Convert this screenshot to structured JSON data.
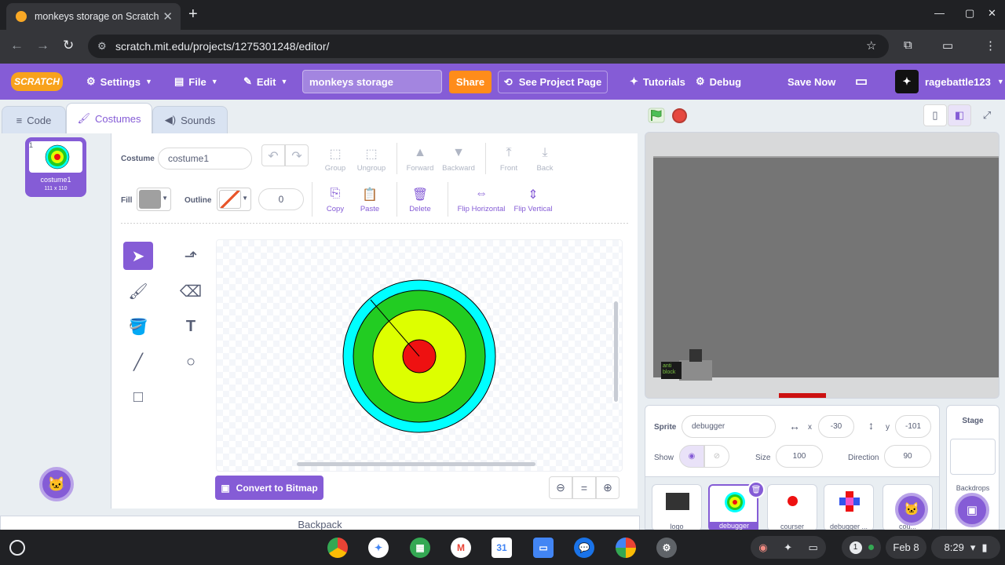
{
  "browser": {
    "tab_title": "monkeys storage on Scratch",
    "url": "scratch.mit.edu/projects/1275301248/editor/"
  },
  "menubar": {
    "logo": "SCRATCH",
    "settings": "Settings",
    "file": "File",
    "edit": "Edit",
    "project_title": "monkeys storage",
    "share": "Share",
    "see_project_page": "See Project Page",
    "tutorials": "Tutorials",
    "debug": "Debug",
    "save_now": "Save Now",
    "username": "ragebattle123"
  },
  "editor_tabs": [
    "Code",
    "Costumes",
    "Sounds"
  ],
  "costume_list": [
    {
      "index": "1",
      "name": "costume1",
      "size": "111 x 110"
    }
  ],
  "paint_editor": {
    "costume_label": "Costume",
    "costume_name": "costume1",
    "fill_label": "Fill",
    "outline_label": "Outline",
    "outline_width": "0",
    "fill_color": "#a0a0a0",
    "toolbar_top": [
      "Group",
      "Ungroup",
      "Forward",
      "Backward",
      "Front",
      "Back"
    ],
    "toolbar_bottom": [
      "Copy",
      "Paste",
      "Delete",
      "Flip Horizontal",
      "Flip Vertical"
    ],
    "convert_button": "Convert to Bitmap",
    "tools": [
      "select-icon",
      "reshape-icon",
      "brush-icon",
      "eraser-icon",
      "fill-icon",
      "text-icon",
      "line-icon",
      "circle-icon",
      "rectangle-icon"
    ]
  },
  "backpack": "Backpack",
  "sprite_info": {
    "sprite_label": "Sprite",
    "sprite_name": "debugger",
    "x_label": "x",
    "x_value": "-30",
    "y_label": "y",
    "y_value": "-101",
    "show_label": "Show",
    "size_label": "Size",
    "size_value": "100",
    "direction_label": "Direction",
    "direction_value": "90"
  },
  "sprites": [
    "logo",
    "debugger",
    "courser",
    "debugger ...",
    "cou..."
  ],
  "stage_pane": {
    "label": "Stage",
    "backdrops_label": "Backdrops"
  },
  "stage_text": "anti block",
  "shelf": {
    "date": "Feb 8",
    "time": "8:29",
    "notif": "1"
  },
  "colors": {
    "scratch_purple": "#855cd6",
    "share_orange": "#ff8c1a"
  }
}
